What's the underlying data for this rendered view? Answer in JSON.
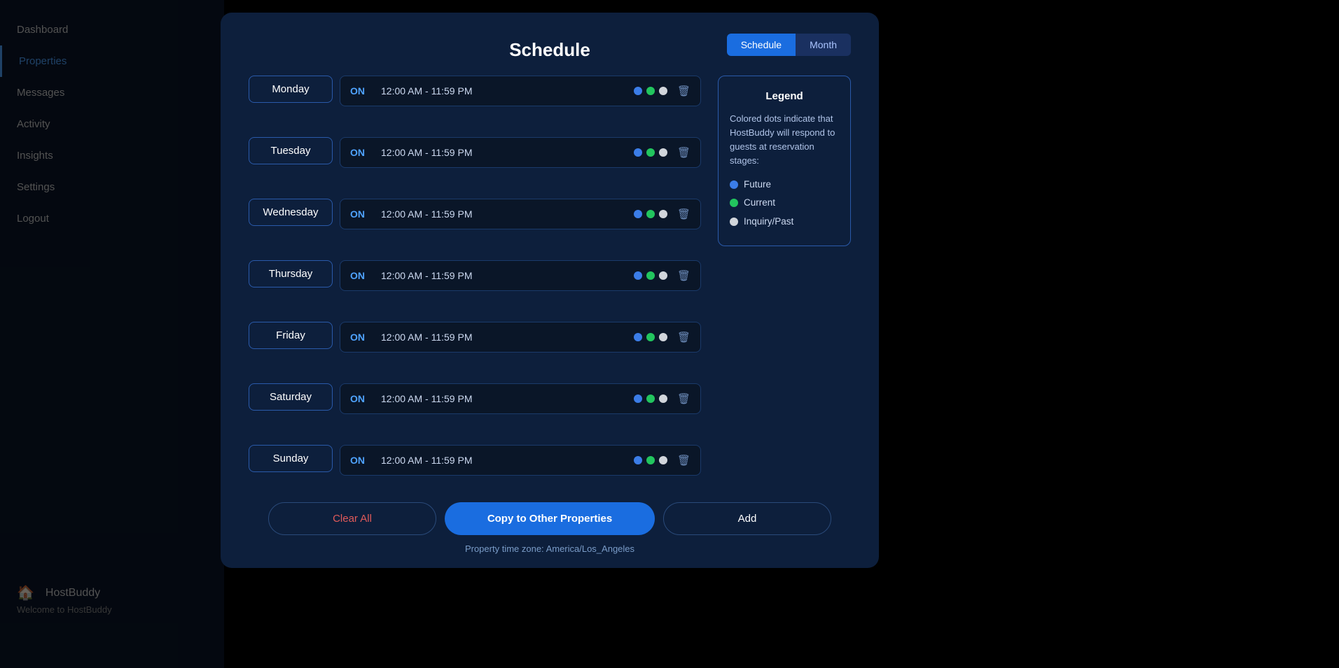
{
  "modal": {
    "title": "Schedule",
    "toggle": {
      "schedule_label": "Schedule",
      "month_label": "Month"
    },
    "days": [
      {
        "name": "Monday",
        "status": "ON",
        "time": "12:00 AM - 11:59 PM"
      },
      {
        "name": "Tuesday",
        "status": "ON",
        "time": "12:00 AM - 11:59 PM"
      },
      {
        "name": "Wednesday",
        "status": "ON",
        "time": "12:00 AM - 11:59 PM"
      },
      {
        "name": "Thursday",
        "status": "ON",
        "time": "12:00 AM - 11:59 PM"
      },
      {
        "name": "Friday",
        "status": "ON",
        "time": "12:00 AM - 11:59 PM"
      },
      {
        "name": "Saturday",
        "status": "ON",
        "time": "12:00 AM - 11:59 PM"
      },
      {
        "name": "Sunday",
        "status": "ON",
        "time": "12:00 AM - 11:59 PM"
      }
    ],
    "legend": {
      "title": "Legend",
      "description": "Colored dots indicate that HostBuddy will respond to guests at reservation stages:",
      "items": [
        {
          "label": "Future",
          "color": "blue"
        },
        {
          "label": "Current",
          "color": "green"
        },
        {
          "label": "Inquiry/Past",
          "color": "white"
        }
      ]
    },
    "footer": {
      "clear_label": "Clear All",
      "copy_label": "Copy to Other Properties",
      "add_label": "Add",
      "timezone": "Property time zone: America/Los_Angeles"
    }
  },
  "sidebar": {
    "items": [
      {
        "label": "Dashboard"
      },
      {
        "label": "Properties",
        "active": true
      },
      {
        "label": "Messages"
      },
      {
        "label": "Activity"
      },
      {
        "label": "Insights"
      },
      {
        "label": "Settings"
      },
      {
        "label": "Logout"
      }
    ],
    "home": {
      "icon": "🏠",
      "label": "HostBuddy",
      "welcome": "Welcome to HostBuddy"
    }
  }
}
